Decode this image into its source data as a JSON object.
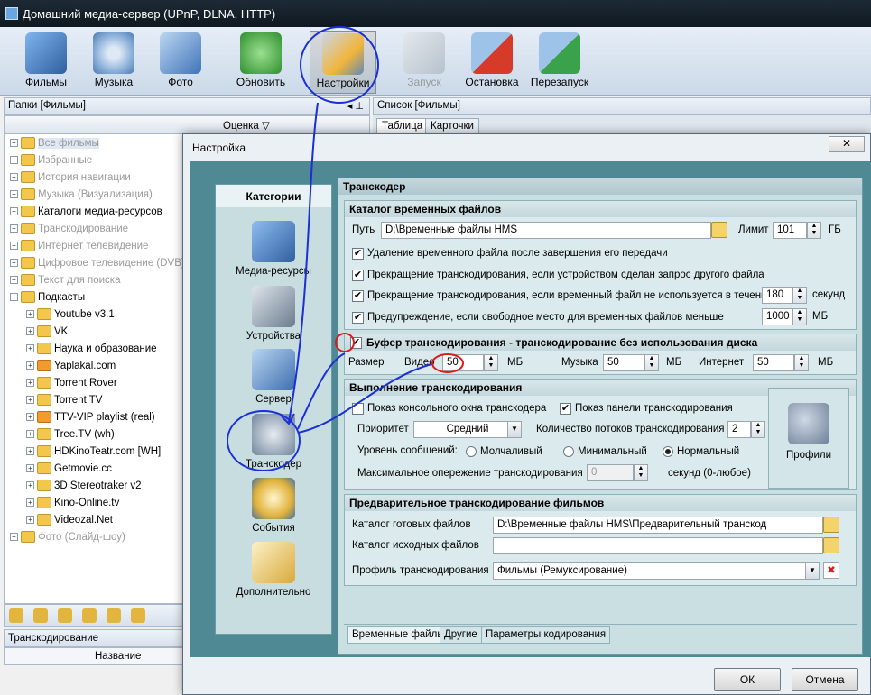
{
  "window": {
    "title": "Домашний медиа-сервер (UPnP, DLNA, HTTP)"
  },
  "toolbar": {
    "buttons": [
      {
        "label": "Фильмы",
        "icon": "film-icon",
        "color": "#3f7cc8"
      },
      {
        "label": "Музыка",
        "icon": "music-icon",
        "color": "#5a9bd6"
      },
      {
        "label": "Фото",
        "icon": "photo-icon",
        "color": "#4a86c9"
      },
      {
        "label": "Обновить",
        "icon": "refresh-icon",
        "color": "#37a640"
      },
      {
        "label": "Настройки",
        "icon": "settings-icon",
        "color": "#4f7fbf"
      },
      {
        "label": "Запуск",
        "icon": "start-icon",
        "color": "#b7c4cf"
      },
      {
        "label": "Остановка",
        "icon": "stop-icon",
        "color": "#d23a2a"
      },
      {
        "label": "Перезапуск",
        "icon": "restart-icon",
        "color": "#3aa24a"
      }
    ]
  },
  "left_panel": {
    "header": "Папки [Фильмы]",
    "column": "Оценка",
    "tree": [
      {
        "label": "Все фильмы",
        "grey": true,
        "selected": true
      },
      {
        "label": "Избранные",
        "grey": true
      },
      {
        "label": "История навигации",
        "grey": true
      },
      {
        "label": "Музыка (Визуализация)",
        "grey": true
      },
      {
        "label": "Каталоги медиа-ресурсов",
        "grey": false
      },
      {
        "label": "Транскодирование",
        "grey": true
      },
      {
        "label": "Интернет телевидение",
        "grey": true
      },
      {
        "label": "Цифровое телевидение (DVB)",
        "grey": true
      },
      {
        "label": "Текст для поиска",
        "grey": true
      },
      {
        "label": "Подкасты",
        "grey": false,
        "expanded": true
      }
    ],
    "podcasts": [
      {
        "label": "Youtube v3.1",
        "rss": false
      },
      {
        "label": "VK",
        "rss": false
      },
      {
        "label": "Наука и образование",
        "rss": false
      },
      {
        "label": "Yaplakal.com",
        "rss": true
      },
      {
        "label": "Torrent Rover",
        "rss": false
      },
      {
        "label": "Torrent TV",
        "rss": false
      },
      {
        "label": "TTV-VIP playlist (real)",
        "rss": true
      },
      {
        "label": "Tree.TV (wh)",
        "rss": false
      },
      {
        "label": "HDKinoTeatr.com [WH]",
        "rss": false
      },
      {
        "label": "Getmovie.cc",
        "rss": false
      },
      {
        "label": "3D Stereotraker v2",
        "rss": false
      },
      {
        "label": "Kino-Online.tv",
        "rss": false
      },
      {
        "label": "Videozal.Net",
        "rss": false
      }
    ],
    "tree_last": {
      "label": "Фото (Слайд-шоу)",
      "grey": true
    },
    "transcoding_header": "Транскодирование",
    "transcoding_column": "Название"
  },
  "right_panel": {
    "header": "Список [Фильмы]",
    "tabs": [
      "Таблица",
      "Карточки"
    ]
  },
  "dialog": {
    "title": "Настройка",
    "close": "✕",
    "categories_title": "Категории",
    "categories": [
      {
        "label": "Медиа-ресурсы",
        "icon": "media-resources-icon"
      },
      {
        "label": "Устройства",
        "icon": "devices-icon"
      },
      {
        "label": "Сервер",
        "icon": "server-icon"
      },
      {
        "label": "Транскодер",
        "icon": "transcoder-icon"
      },
      {
        "label": "События",
        "icon": "events-icon"
      },
      {
        "label": "Дополнительно",
        "icon": "advanced-icon"
      }
    ],
    "section_title": "Транскодер",
    "temp_dir": {
      "title": "Каталог временных файлов",
      "path_label": "Путь",
      "path_value": "D:\\Временные файлы HMS",
      "limit_label": "Лимит",
      "limit_value": "101",
      "limit_unit": "ГБ",
      "options": [
        {
          "label": "Удаление временного файла после завершения его передачи",
          "checked": true
        },
        {
          "label": "Прекращение транскодирования, если устройством сделан запрос другого файла",
          "checked": true
        },
        {
          "label": "Прекращение транскодирования, если временный файл не используется в течение",
          "checked": true,
          "value": "180",
          "unit": "секунд"
        },
        {
          "label": "Предупреждение, если свободное место для временных файлов меньше",
          "checked": true,
          "value": "1000",
          "unit": "МБ"
        }
      ]
    },
    "buffer": {
      "title": "Буфер транскодирования - транскодирование без использования диска",
      "checked": true,
      "size_label": "Размер",
      "video_label": "Видео",
      "video_value": "50",
      "video_unit": "МБ",
      "music_label": "Музыка",
      "music_value": "50",
      "music_unit": "МБ",
      "internet_label": "Интернет",
      "internet_value": "50",
      "internet_unit": "МБ"
    },
    "execution": {
      "title": "Выполнение транскодирования",
      "console_label": "Показ консольного окна транскодера",
      "console_checked": false,
      "panel_label": "Показ панели транскодирования",
      "panel_checked": true,
      "priority_label": "Приоритет",
      "priority_value": "Средний",
      "threads_label": "Количество потоков транскодирования",
      "threads_value": "2",
      "log_label": "Уровень сообщений:",
      "log_options": [
        "Молчаливый",
        "Минимальный",
        "Нормальный"
      ],
      "log_selected": "Нормальный",
      "advance_label": "Максимальное опережение транскодирования",
      "advance_value": "0",
      "advance_unit": "секунд (0-любое)",
      "profiles_label": "Профили"
    },
    "pre": {
      "title": "Предварительное транскодирование фильмов",
      "ready_label": "Каталог готовых файлов",
      "ready_value": "D:\\Временные файлы HMS\\Предварительный транскод",
      "source_label": "Каталог исходных файлов",
      "source_value": "",
      "profile_label": "Профиль транскодирования",
      "profile_value": "Фильмы (Ремуксирование)"
    },
    "bottom_tabs": [
      "Временные файлы",
      "Другие",
      "Параметры кодирования"
    ],
    "ok": "ОК",
    "cancel": "Отмена"
  },
  "colors": {
    "annotation": "#1a2fd6",
    "annotation_red": "#e01818",
    "dialog_bg": "#4f8993"
  }
}
